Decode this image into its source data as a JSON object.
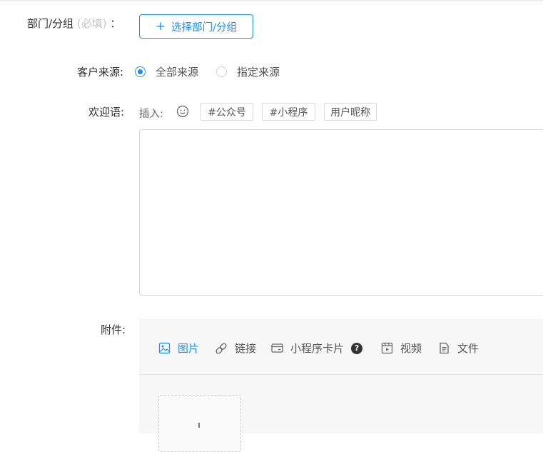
{
  "department": {
    "label": "部门/分组",
    "required_hint": "(必填)",
    "colon": "：",
    "button_label": "选择部门/分组"
  },
  "customer_source": {
    "label": "客户来源:",
    "options": [
      {
        "label": "全部来源",
        "checked": true
      },
      {
        "label": "指定来源",
        "checked": false
      }
    ]
  },
  "welcome": {
    "label": "欢迎语:",
    "insert_label": "插入:",
    "tags": [
      "#公众号",
      "#小程序",
      "用户昵称"
    ],
    "text": ""
  },
  "attachments": {
    "label": "附件:",
    "tabs": [
      {
        "label": "图片",
        "icon": "image-icon",
        "active": true
      },
      {
        "label": "链接",
        "icon": "link-icon",
        "active": false
      },
      {
        "label": "小程序卡片",
        "icon": "card-icon",
        "active": false,
        "help": "?"
      },
      {
        "label": "视频",
        "icon": "video-icon",
        "active": false
      },
      {
        "label": "文件",
        "icon": "file-icon",
        "active": false
      }
    ]
  },
  "colors": {
    "accent": "#1e8ff0",
    "text": "#333333",
    "muted": "#c5c5c5",
    "border": "#d6d6d6"
  }
}
